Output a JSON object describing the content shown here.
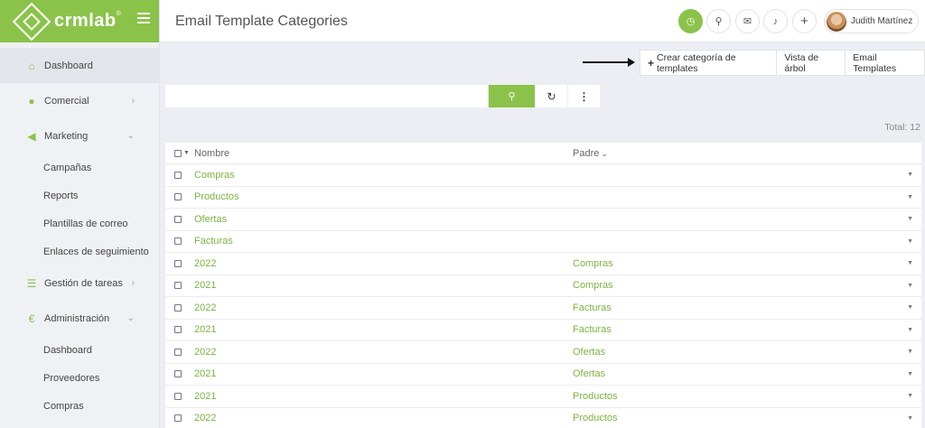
{
  "app": {
    "logo_text": "crmlab",
    "logo_mark": "®"
  },
  "sidebar": {
    "items": [
      {
        "label": "Dashboard",
        "icon": "home-icon",
        "active": true
      },
      {
        "label": "Comercial",
        "icon": "person-icon",
        "chevron": "›"
      },
      {
        "label": "Marketing",
        "icon": "megaphone-icon",
        "chevron": "⌄"
      },
      {
        "label": "Campañas",
        "sub": true
      },
      {
        "label": "Reports",
        "sub": true
      },
      {
        "label": "Plantillas de correo",
        "sub": true
      },
      {
        "label": "Enlaces de seguimiento",
        "sub": true
      },
      {
        "label": "Gestión de tareas",
        "icon": "tasks-icon",
        "chevron": "›"
      },
      {
        "label": "Administración",
        "icon": "euro-icon",
        "chevron": "⌄"
      },
      {
        "label": "Dashboard",
        "sub": true
      },
      {
        "label": "Proveedores",
        "sub": true
      },
      {
        "label": "Compras",
        "sub": true
      }
    ]
  },
  "header": {
    "title": "Email Template Categories",
    "user_name": "Judith Martínez"
  },
  "actions": {
    "create": "Crear categoría de templates",
    "tree": "Vista de árbol",
    "templates": "Email Templates"
  },
  "search": {
    "placeholder": ""
  },
  "total": "Total: 12",
  "table": {
    "columns": {
      "name": "Nombre",
      "parent": "Padre"
    },
    "rows": [
      {
        "name": "Compras",
        "parent": ""
      },
      {
        "name": "Productos",
        "parent": ""
      },
      {
        "name": "Ofertas",
        "parent": ""
      },
      {
        "name": "Facturas",
        "parent": ""
      },
      {
        "name": "2022",
        "parent": "Compras"
      },
      {
        "name": "2021",
        "parent": "Compras"
      },
      {
        "name": "2022",
        "parent": "Facturas"
      },
      {
        "name": "2021",
        "parent": "Facturas"
      },
      {
        "name": "2022",
        "parent": "Ofertas"
      },
      {
        "name": "2021",
        "parent": "Ofertas"
      },
      {
        "name": "2021",
        "parent": "Productos"
      },
      {
        "name": "2022",
        "parent": "Productos"
      }
    ]
  },
  "colors": {
    "accent": "#8bc34a",
    "link": "#7cb342"
  }
}
